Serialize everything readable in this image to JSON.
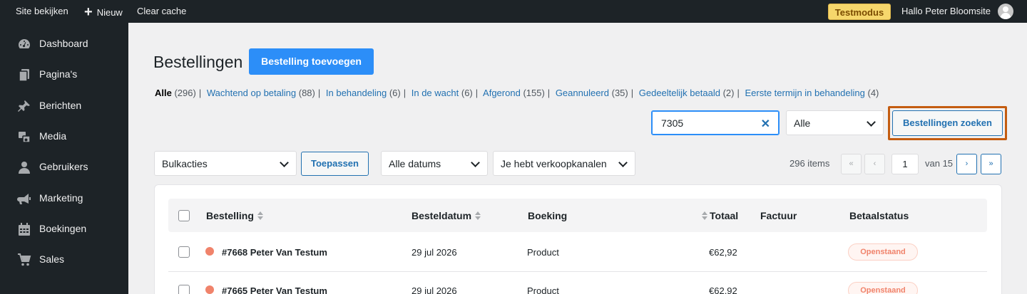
{
  "adminbar": {
    "site_link": "Site bekijken",
    "new_label": "Nieuw",
    "clear_cache": "Clear cache",
    "test_mode": "Testmodus",
    "greeting": "Hallo Peter Bloomsite"
  },
  "sidebar": {
    "items": [
      {
        "label": "Dashboard",
        "icon": "dashboard-icon"
      },
      {
        "label": "Pagina's",
        "icon": "pages-icon"
      },
      {
        "label": "Berichten",
        "icon": "pin-icon"
      },
      {
        "label": "Media",
        "icon": "media-icon"
      },
      {
        "label": "Gebruikers",
        "icon": "user-icon"
      },
      {
        "label": "Marketing",
        "icon": "megaphone-icon"
      },
      {
        "label": "Boekingen",
        "icon": "calendar-icon"
      },
      {
        "label": "Sales",
        "icon": "cart-icon"
      }
    ]
  },
  "page": {
    "title": "Bestellingen",
    "add_button": "Bestelling toevoegen"
  },
  "filters": [
    {
      "label": "Alle",
      "count": "(296)"
    },
    {
      "label": "Wachtend op betaling",
      "count": "(88)"
    },
    {
      "label": "In behandeling",
      "count": "(6)"
    },
    {
      "label": "In de wacht",
      "count": "(6)"
    },
    {
      "label": "Afgerond",
      "count": "(155)"
    },
    {
      "label": "Geannuleerd",
      "count": "(35)"
    },
    {
      "label": "Gedeeltelijk betaald",
      "count": "(2)"
    },
    {
      "label": "Eerste termijn in behandeling",
      "count": "(4)"
    }
  ],
  "search": {
    "value": "7305",
    "scope": "Alle",
    "button": "Bestellingen zoeken"
  },
  "toolbar": {
    "bulk_actions": "Bulkacties",
    "apply": "Toepassen",
    "dates": "Alle datums",
    "channels": "Je hebt verkoopkanalen"
  },
  "pagination": {
    "items": "296 items",
    "first": "«",
    "prev": "‹",
    "current_page": "1",
    "of_total": "van 15",
    "next": "›",
    "last": "»"
  },
  "table": {
    "columns": [
      "Bestelling",
      "Besteldatum",
      "Boeking",
      "Totaal",
      "Factuur",
      "Betaalstatus"
    ],
    "rows": [
      {
        "order": "#7668 Peter Van Testum",
        "date": "29 jul 2026",
        "booking": "Product",
        "total": "€62,92",
        "invoice": "",
        "status": "Openstaand",
        "status_color": "#f0836b"
      },
      {
        "order": "#7665 Peter Van Testum",
        "date": "29 jul 2026",
        "booking": "Product",
        "total": "€62,92",
        "invoice": "",
        "status": "Openstaand",
        "status_color": "#f0836b"
      }
    ]
  },
  "colors": {
    "primary": "#2c8ef8",
    "link": "#2271b1",
    "sidebar_bg": "#1d2327",
    "highlight_border": "#c45c10",
    "test_mode_bg": "#f6d76c"
  }
}
